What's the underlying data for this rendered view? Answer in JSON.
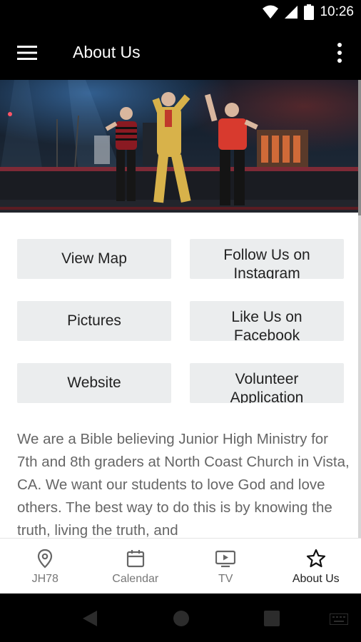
{
  "status_bar": {
    "time": "10:26",
    "icons": [
      "wifi-icon",
      "cell-signal-icon",
      "battery-icon"
    ]
  },
  "app_bar": {
    "title": "About Us",
    "menu_icon": "hamburger-menu-icon",
    "overflow_icon": "more-vert-icon"
  },
  "hero_image": {
    "description_icon": "stage-photo"
  },
  "buttons": [
    {
      "label": "View Map"
    },
    {
      "label": "Follow Us on Instagram"
    },
    {
      "label": "Pictures"
    },
    {
      "label": "Like Us on Facebook"
    },
    {
      "label": "Website"
    },
    {
      "label": "Volunteer Application"
    }
  ],
  "about": {
    "text": "We are a Bible believing Junior High Ministry for 7th and 8th graders at North Coast Church in Vista, CA. We want our students to love God and love others. The best way to do this is by knowing the truth, living the truth, and"
  },
  "bottom_nav": {
    "items": [
      {
        "label": "JH78",
        "icon": "location-pin-icon",
        "active": false
      },
      {
        "label": "Calendar",
        "icon": "calendar-icon",
        "active": false
      },
      {
        "label": "TV",
        "icon": "tv-play-icon",
        "active": false
      },
      {
        "label": "About Us",
        "icon": "star-icon",
        "active": true
      }
    ]
  },
  "colors": {
    "app_bar": "#000000",
    "button_bg": "#EBEDEE",
    "body_text": "#666666",
    "nav_text": "#777777"
  }
}
